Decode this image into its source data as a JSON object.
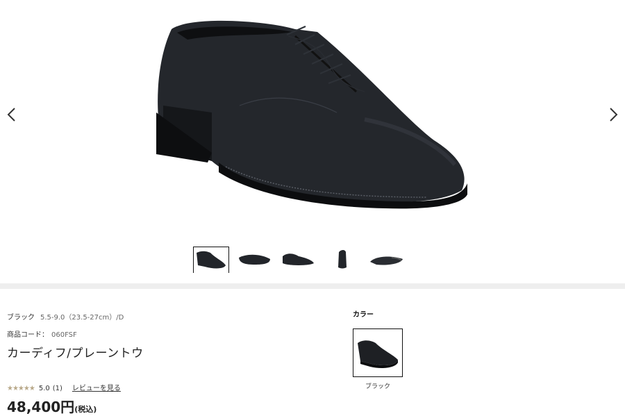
{
  "gallery": {
    "prev_icon": "chevron-left-icon",
    "next_icon": "chevron-right-icon",
    "thumbnails": [
      {
        "view": "side-angle",
        "active": true
      },
      {
        "view": "side",
        "active": false
      },
      {
        "view": "side-outer",
        "active": false
      },
      {
        "view": "back",
        "active": false
      },
      {
        "view": "sole",
        "active": false
      }
    ]
  },
  "product": {
    "color_name": "ブラック",
    "spec": "5.5-9.0（23.5-27cm）/D",
    "code_label": "商品コード：",
    "code_value": "060FSF",
    "title": "カーディフ/プレーントウ",
    "rating": {
      "stars": "★★★★★",
      "value": "5.0",
      "count": "(1)",
      "review_link": "レビューを見る",
      "score": 5.0,
      "max": 5
    },
    "price": "48,400円",
    "tax_label": "(税込)"
  },
  "color_selector": {
    "label": "カラー",
    "options": [
      {
        "name": "ブラック",
        "selected": true
      }
    ]
  },
  "colors": {
    "divider": "#eeeeee",
    "star": "#b9a98a",
    "shoe": "#1e2024"
  }
}
